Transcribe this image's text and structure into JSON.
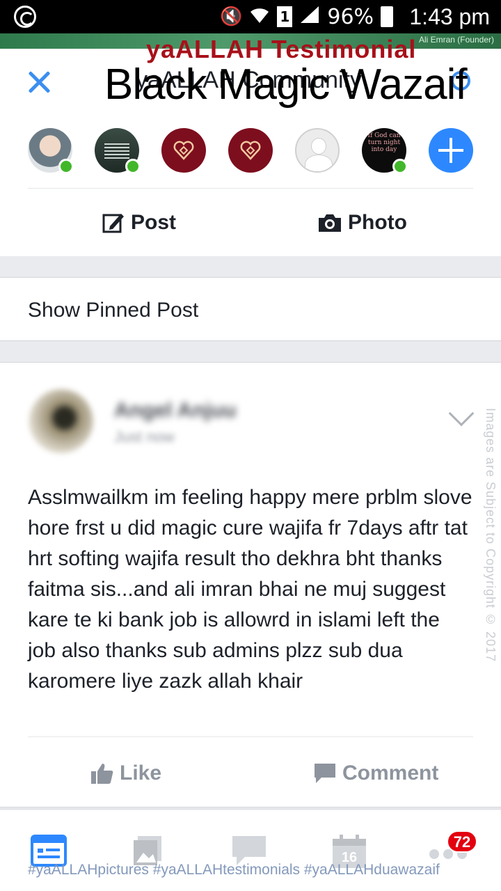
{
  "status_bar": {
    "sim_slot": "1",
    "battery": "96%",
    "time": "1:43 pm"
  },
  "banner": {
    "caption": "Ali Emran (Founder)"
  },
  "header": {
    "title": "yaALLAH Community",
    "close_icon": "close-icon",
    "search_icon": "search-icon"
  },
  "overlays": {
    "testimonial": "yaALLAH Testimonial",
    "wazaif": "Black Magic Wazaif",
    "side_watermark": "Images are Subject to Copyright © 2017",
    "hashtags": "#yaALLAHpictures #yaALLAHtestimonials #yaALLAHduawazaif"
  },
  "members": {
    "avatar6_text": "If God can turn night into day",
    "add_icon": "plus-icon"
  },
  "composer": {
    "post_label": "Post",
    "photo_label": "Photo"
  },
  "pinned": {
    "label": "Show Pinned Post"
  },
  "post": {
    "author": "Angel Anjuu",
    "time": "Just now",
    "body": "Asslmwailkm im feeling happy mere prblm slove hore frst u did magic cure wajifa fr 7days aftr tat hrt softing wajifa result tho dekhra bht thanks faitma sis...and ali imran bhai ne muj suggest kare te ki bank job is allowrd in islami left the job also thanks sub admins plzz sub dua karomere liye zazk allah khair",
    "like_label": "Like",
    "comment_label": "Comment"
  },
  "bottom_nav": {
    "events_day": "16",
    "notification_count": "72"
  },
  "colors": {
    "accent": "#3b8ef0",
    "add_button": "#2d88ff",
    "online": "#42b72a",
    "badge": "#e3000f",
    "overlay_red": "#a8101a",
    "heart_bg": "#7d0e1e"
  }
}
